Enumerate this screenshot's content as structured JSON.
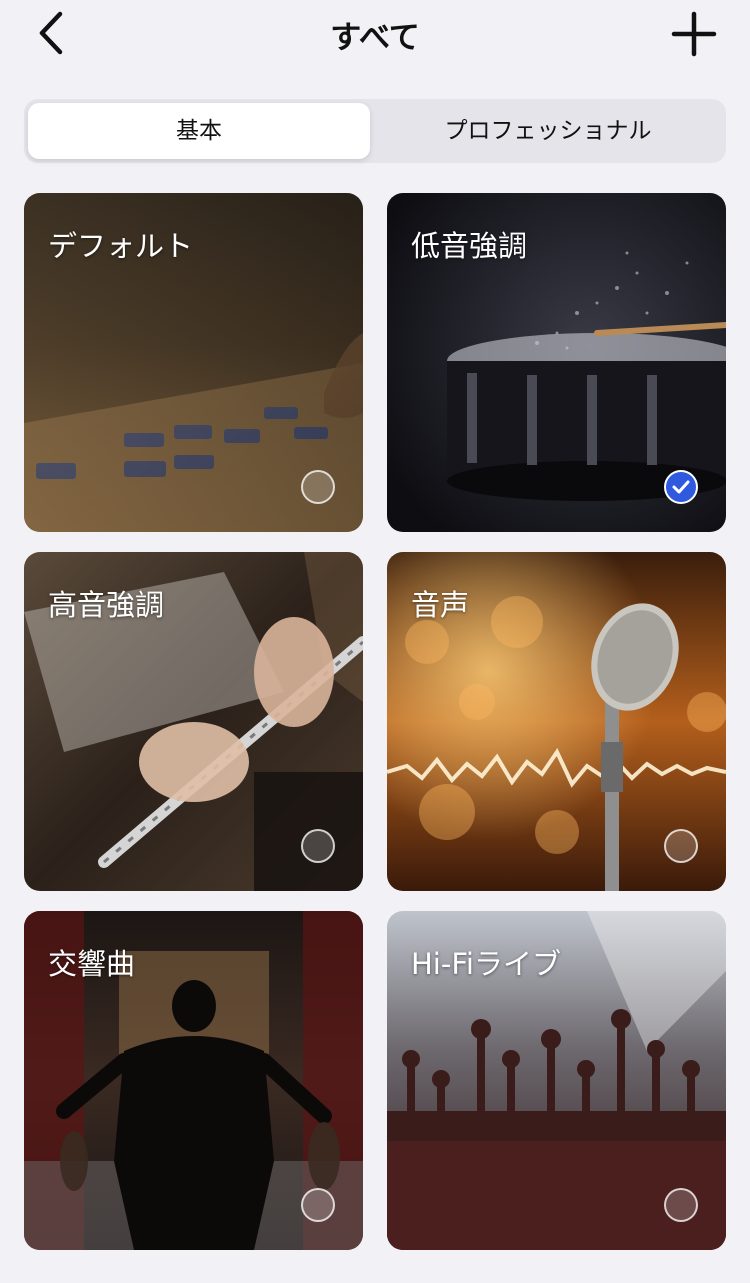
{
  "header": {
    "title": "すべて",
    "back_icon": "chevron-left-icon",
    "add_icon": "plus-icon"
  },
  "segments": {
    "basic": "基本",
    "professional": "プロフェッショナル",
    "selected": "basic"
  },
  "presets": [
    {
      "id": "default",
      "label": "デフォルト",
      "selected": false
    },
    {
      "id": "bass-boost",
      "label": "低音強調",
      "selected": true
    },
    {
      "id": "treble-boost",
      "label": "高音強調",
      "selected": false
    },
    {
      "id": "vocal",
      "label": "音声",
      "selected": false
    },
    {
      "id": "symphony",
      "label": "交響曲",
      "selected": false
    },
    {
      "id": "hifi-live",
      "label": "Hi-Fiライブ",
      "selected": false
    }
  ],
  "colors": {
    "accent": "#2f5ae0",
    "background": "#f2f2f6"
  }
}
